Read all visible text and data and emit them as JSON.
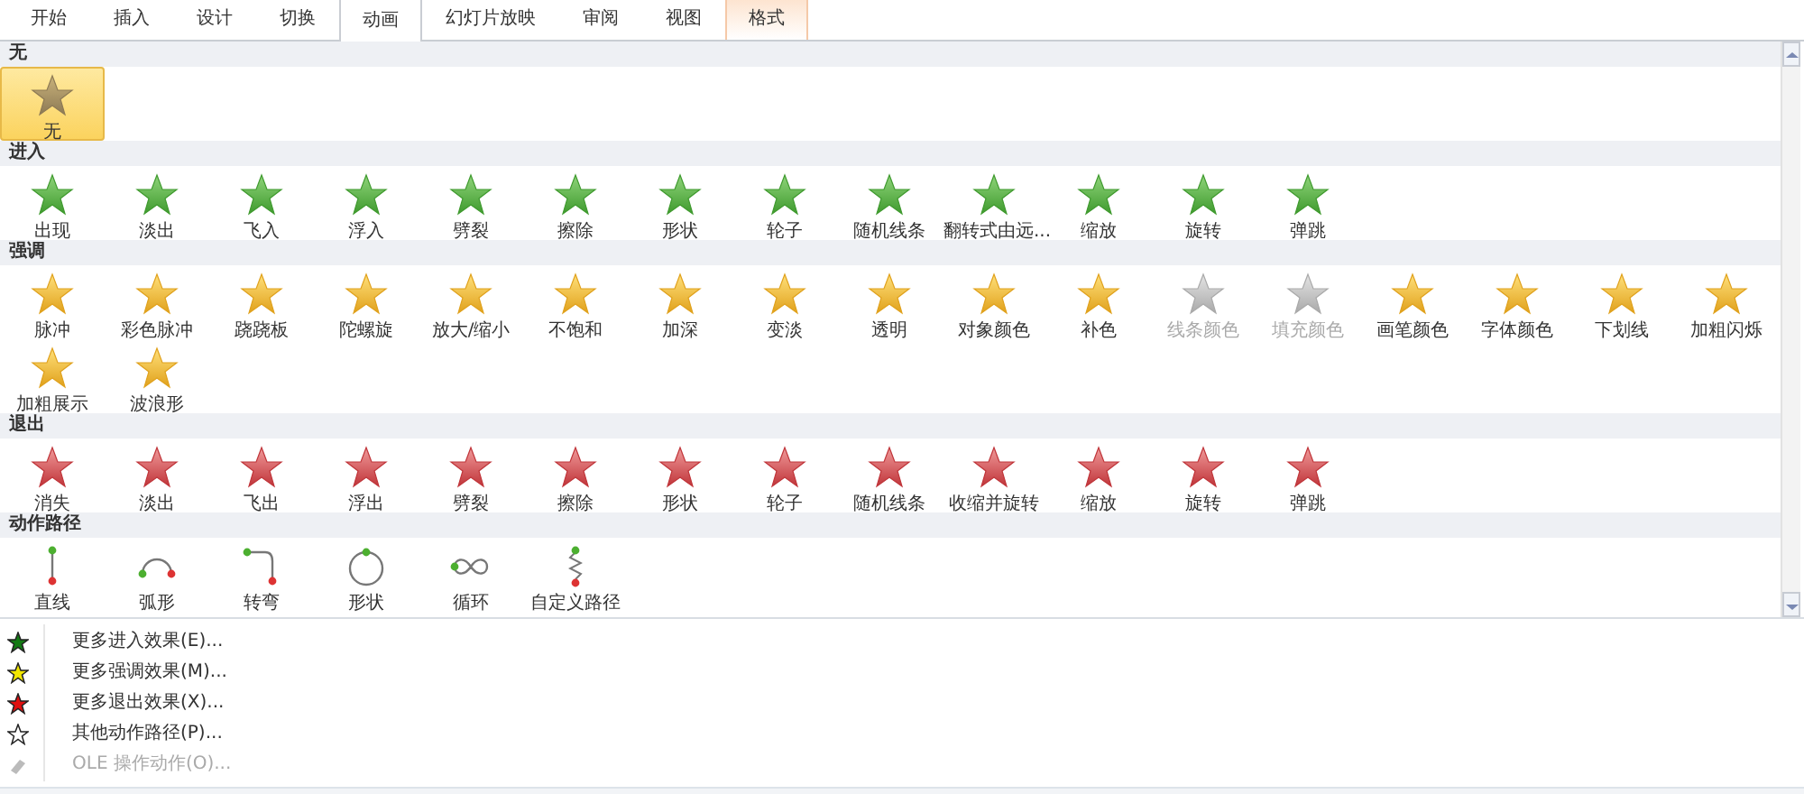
{
  "tabs": [
    {
      "label": "开始",
      "selected": false,
      "kind": "normal"
    },
    {
      "label": "插入",
      "selected": false,
      "kind": "normal"
    },
    {
      "label": "设计",
      "selected": false,
      "kind": "normal"
    },
    {
      "label": "切换",
      "selected": false,
      "kind": "normal"
    },
    {
      "label": "动画",
      "selected": true,
      "kind": "normal"
    },
    {
      "label": "幻灯片放映",
      "selected": false,
      "kind": "normal"
    },
    {
      "label": "审阅",
      "selected": false,
      "kind": "normal"
    },
    {
      "label": "视图",
      "selected": false,
      "kind": "normal"
    },
    {
      "label": "格式",
      "selected": false,
      "kind": "contextual"
    }
  ],
  "sections": [
    {
      "title": "无",
      "kind": "none",
      "items": [
        {
          "label": "无",
          "selected": true,
          "disabled": false
        }
      ]
    },
    {
      "title": "进入",
      "kind": "entrance",
      "items": [
        {
          "label": "出现",
          "selected": false,
          "disabled": false
        },
        {
          "label": "淡出",
          "selected": false,
          "disabled": false
        },
        {
          "label": "飞入",
          "selected": false,
          "disabled": false
        },
        {
          "label": "浮入",
          "selected": false,
          "disabled": false
        },
        {
          "label": "劈裂",
          "selected": false,
          "disabled": false
        },
        {
          "label": "擦除",
          "selected": false,
          "disabled": false
        },
        {
          "label": "形状",
          "selected": false,
          "disabled": false
        },
        {
          "label": "轮子",
          "selected": false,
          "disabled": false
        },
        {
          "label": "随机线条",
          "selected": false,
          "disabled": false
        },
        {
          "label": "翻转式由远...",
          "selected": false,
          "disabled": false
        },
        {
          "label": "缩放",
          "selected": false,
          "disabled": false
        },
        {
          "label": "旋转",
          "selected": false,
          "disabled": false
        },
        {
          "label": "弹跳",
          "selected": false,
          "disabled": false
        }
      ]
    },
    {
      "title": "强调",
      "kind": "emphasis",
      "items": [
        {
          "label": "脉冲",
          "selected": false,
          "disabled": false
        },
        {
          "label": "彩色脉冲",
          "selected": false,
          "disabled": false
        },
        {
          "label": "跷跷板",
          "selected": false,
          "disabled": false
        },
        {
          "label": "陀螺旋",
          "selected": false,
          "disabled": false
        },
        {
          "label": "放大/缩小",
          "selected": false,
          "disabled": false
        },
        {
          "label": "不饱和",
          "selected": false,
          "disabled": false
        },
        {
          "label": "加深",
          "selected": false,
          "disabled": false
        },
        {
          "label": "变淡",
          "selected": false,
          "disabled": false
        },
        {
          "label": "透明",
          "selected": false,
          "disabled": false
        },
        {
          "label": "对象颜色",
          "selected": false,
          "disabled": false
        },
        {
          "label": "补色",
          "selected": false,
          "disabled": false
        },
        {
          "label": "线条颜色",
          "selected": false,
          "disabled": true
        },
        {
          "label": "填充颜色",
          "selected": false,
          "disabled": true
        },
        {
          "label": "画笔颜色",
          "selected": false,
          "disabled": false
        },
        {
          "label": "字体颜色",
          "selected": false,
          "disabled": false
        },
        {
          "label": "下划线",
          "selected": false,
          "disabled": false
        },
        {
          "label": "加粗闪烁",
          "selected": false,
          "disabled": false
        },
        {
          "label": "加粗展示",
          "selected": false,
          "disabled": false
        },
        {
          "label": "波浪形",
          "selected": false,
          "disabled": false
        }
      ]
    },
    {
      "title": "退出",
      "kind": "exit",
      "items": [
        {
          "label": "消失",
          "selected": false,
          "disabled": false
        },
        {
          "label": "淡出",
          "selected": false,
          "disabled": false
        },
        {
          "label": "飞出",
          "selected": false,
          "disabled": false
        },
        {
          "label": "浮出",
          "selected": false,
          "disabled": false
        },
        {
          "label": "劈裂",
          "selected": false,
          "disabled": false
        },
        {
          "label": "擦除",
          "selected": false,
          "disabled": false
        },
        {
          "label": "形状",
          "selected": false,
          "disabled": false
        },
        {
          "label": "轮子",
          "selected": false,
          "disabled": false
        },
        {
          "label": "随机线条",
          "selected": false,
          "disabled": false
        },
        {
          "label": "收缩并旋转",
          "selected": false,
          "disabled": false
        },
        {
          "label": "缩放",
          "selected": false,
          "disabled": false
        },
        {
          "label": "旋转",
          "selected": false,
          "disabled": false
        },
        {
          "label": "弹跳",
          "selected": false,
          "disabled": false
        }
      ]
    },
    {
      "title": "动作路径",
      "kind": "path",
      "items": [
        {
          "label": "直线",
          "selected": false,
          "disabled": false,
          "kind": "line"
        },
        {
          "label": "弧形",
          "selected": false,
          "disabled": false,
          "kind": "arc"
        },
        {
          "label": "转弯",
          "selected": false,
          "disabled": false,
          "kind": "turn"
        },
        {
          "label": "形状",
          "selected": false,
          "disabled": false,
          "kind": "circle"
        },
        {
          "label": "循环",
          "selected": false,
          "disabled": false,
          "kind": "loop"
        },
        {
          "label": "自定义路径",
          "selected": false,
          "disabled": false,
          "kind": "custom"
        }
      ]
    }
  ],
  "menu": [
    {
      "label": "更多进入效果(E)...",
      "kind": "entrance",
      "disabled": false
    },
    {
      "label": "更多强调效果(M)...",
      "kind": "emphasis",
      "disabled": false
    },
    {
      "label": "更多退出效果(X)...",
      "kind": "exit",
      "disabled": false
    },
    {
      "label": "其他动作路径(P)...",
      "kind": "path",
      "disabled": false
    },
    {
      "label": "OLE 操作动作(O)...",
      "kind": "ole",
      "disabled": true
    }
  ]
}
